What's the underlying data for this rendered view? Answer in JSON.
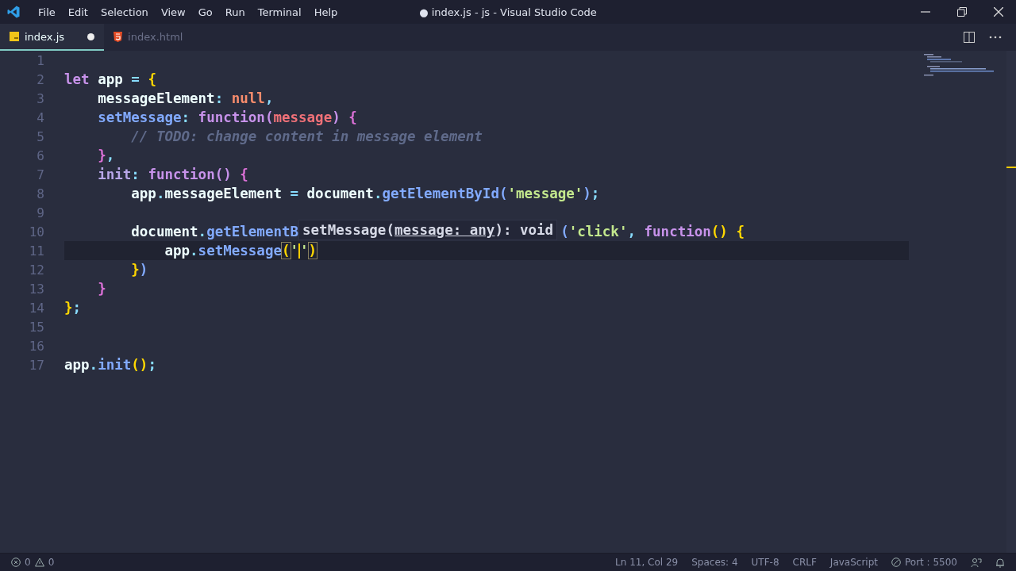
{
  "window": {
    "title": "● index.js - js - Visual Studio Code"
  },
  "menu": [
    "File",
    "Edit",
    "Selection",
    "View",
    "Go",
    "Run",
    "Terminal",
    "Help"
  ],
  "tabs": [
    {
      "label": "index.js",
      "kind": "js",
      "selected": true,
      "modified": true
    },
    {
      "label": "index.html",
      "kind": "html",
      "selected": false,
      "modified": false
    }
  ],
  "editor": {
    "lines": [
      {
        "number": "1",
        "current": false
      },
      {
        "number": "2",
        "current": false,
        "tokens": [
          {
            "text": "let",
            "kind": "kw"
          },
          {
            "text": " app ",
            "kind": "var"
          },
          {
            "text": "=",
            "kind": "op"
          },
          {
            "text": " {",
            "kind": "b1"
          }
        ]
      },
      {
        "number": "3",
        "current": false,
        "tokens": [
          {
            "text": "    messageElement",
            "kind": "var"
          },
          {
            "text": ": ",
            "kind": "punct"
          },
          {
            "text": "null",
            "kind": "null"
          },
          {
            "text": ",",
            "kind": "punct"
          }
        ]
      },
      {
        "number": "4",
        "current": false,
        "tokens": [
          {
            "text": "    setMessage",
            "kind": "method"
          },
          {
            "text": ": ",
            "kind": "punct"
          },
          {
            "text": "function(",
            "kind": "kw"
          },
          {
            "text": "message",
            "kind": "param"
          },
          {
            "text": ")",
            "kind": "kw"
          },
          {
            "text": " {",
            "kind": "b2"
          }
        ]
      },
      {
        "number": "5",
        "current": false,
        "tokens": [
          {
            "text": "        // TODO: change content in message element",
            "kind": "comment"
          }
        ]
      },
      {
        "number": "6",
        "current": false,
        "tokens": [
          {
            "text": "    }",
            "kind": "b2"
          },
          {
            "text": ",",
            "kind": "punct"
          }
        ]
      },
      {
        "number": "7",
        "current": false,
        "tokens": [
          {
            "text": "    init",
            "kind": "lav"
          },
          {
            "text": ": ",
            "kind": "punct"
          },
          {
            "text": "function()",
            "kind": "kw"
          },
          {
            "text": " {",
            "kind": "b2"
          }
        ]
      },
      {
        "number": "8",
        "current": false,
        "tokens": [
          {
            "text": "        app",
            "kind": "var"
          },
          {
            "text": ".",
            "kind": "punct"
          },
          {
            "text": "messageElement ",
            "kind": "var"
          },
          {
            "text": "=",
            "kind": "op"
          },
          {
            "text": " document",
            "kind": "var"
          },
          {
            "text": ".",
            "kind": "punct"
          },
          {
            "text": "getElementById",
            "kind": "method"
          },
          {
            "text": "(",
            "kind": "b3"
          },
          {
            "text": "'message'",
            "kind": "str"
          },
          {
            "text": ")",
            "kind": "b3"
          },
          {
            "text": ";",
            "kind": "punct"
          }
        ]
      },
      {
        "number": "9",
        "current": false
      },
      {
        "number": "10",
        "current": false,
        "tokens": [
          {
            "text": "        document",
            "kind": "var"
          },
          {
            "text": ".",
            "kind": "punct"
          },
          {
            "text": "getElementB",
            "kind": "method"
          },
          {
            "kind": "hover"
          },
          {
            "text": "(",
            "kind": "b3"
          },
          {
            "text": "'click'",
            "kind": "str"
          },
          {
            "text": ", ",
            "kind": "punct"
          },
          {
            "text": "function",
            "kind": "kw"
          },
          {
            "text": "()",
            "kind": "b1"
          },
          {
            "text": " {",
            "kind": "b1"
          }
        ]
      },
      {
        "number": "11",
        "current": true,
        "tokens": [
          {
            "text": "            app",
            "kind": "var"
          },
          {
            "text": ".",
            "kind": "punct"
          },
          {
            "text": "setMessage",
            "kind": "method"
          },
          {
            "text": "(",
            "kind": "match"
          },
          {
            "text": "'",
            "kind": "str"
          },
          {
            "kind": "cursor"
          },
          {
            "text": "'",
            "kind": "str"
          },
          {
            "text": ")",
            "kind": "match"
          }
        ]
      },
      {
        "number": "12",
        "current": false,
        "tokens": [
          {
            "text": "        }",
            "kind": "b1"
          },
          {
            "text": ")",
            "kind": "b3"
          }
        ]
      },
      {
        "number": "13",
        "current": false,
        "tokens": [
          {
            "text": "    }",
            "kind": "b2"
          }
        ]
      },
      {
        "number": "14",
        "current": false,
        "tokens": [
          {
            "text": "}",
            "kind": "b1"
          },
          {
            "text": ";",
            "kind": "punct"
          }
        ]
      },
      {
        "number": "15",
        "current": false
      },
      {
        "number": "16",
        "current": false
      },
      {
        "number": "17",
        "current": false,
        "tokens": [
          {
            "text": "app",
            "kind": "var"
          },
          {
            "text": ".",
            "kind": "punct"
          },
          {
            "text": "init",
            "kind": "method"
          },
          {
            "text": "()",
            "kind": "b1"
          },
          {
            "text": ";",
            "kind": "punct"
          }
        ]
      }
    ],
    "hover": {
      "name": "setMessage(",
      "param": "message: any",
      "rest": "): void"
    }
  },
  "status_bar": {
    "errors": "0",
    "warnings": "0",
    "items": [
      "Ln 11, Col 29",
      "Spaces: 4",
      "UTF-8",
      "CRLF",
      "JavaScript"
    ],
    "port": "Port : 5500"
  }
}
